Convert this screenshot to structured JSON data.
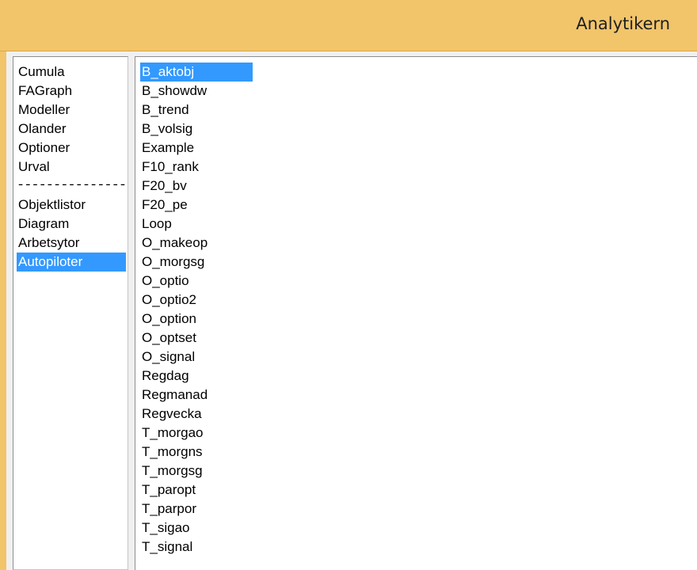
{
  "window": {
    "title": "Analytikern"
  },
  "left_panel": {
    "items": [
      "Cumula",
      "FAGraph",
      "Modeller",
      "Olander",
      "Optioner",
      "Urval",
      "--------------------------",
      "Objektlistor",
      "Diagram",
      "Arbetsytor",
      "Autopiloter"
    ],
    "selected_item": "Autopiloter"
  },
  "right_panel": {
    "items": [
      "B_aktobj",
      "B_showdw",
      "B_trend",
      "B_volsig",
      "Example",
      "F10_rank",
      "F20_bv",
      "F20_pe",
      "Loop",
      "O_makeop",
      "O_morgsg",
      "O_optio",
      "O_optio2",
      "O_option",
      "O_optset",
      "O_signal",
      "Regdag",
      "Regmanad",
      "Regvecka",
      "T_morgao",
      "T_morgns",
      "T_morgsg",
      "T_paropt",
      "T_parpor",
      "T_sigao",
      "T_signal"
    ],
    "selected_item": "B_aktobj"
  },
  "colors": {
    "titlebar": "#f2c56b",
    "selection": "#3399ff",
    "panel_background": "#ffffff"
  }
}
